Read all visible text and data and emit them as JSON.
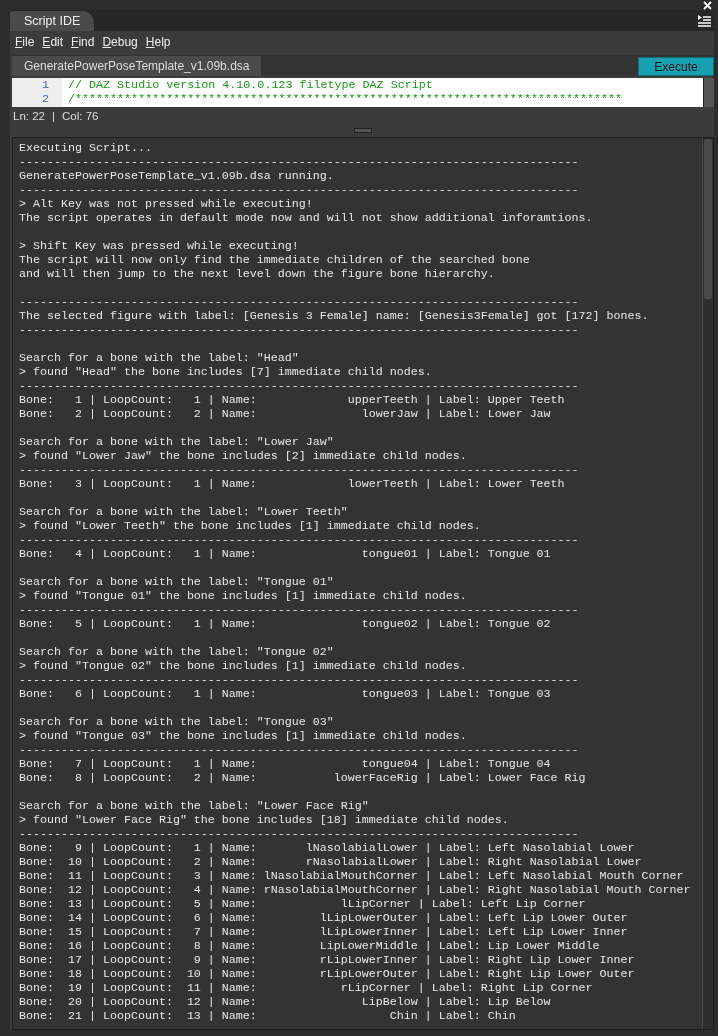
{
  "window": {
    "title": "Script IDE",
    "selected": true
  },
  "menu": [
    "File",
    "Edit",
    "Find",
    "Debug",
    "Help"
  ],
  "file_tab": {
    "label": "GeneratePowerPoseTemplate_v1.09b.dsa",
    "selected": true
  },
  "execute_button": "Execute",
  "editor": {
    "lines": [
      {
        "number": "1",
        "text": "// DAZ Studio version 4.10.0.123 filetype DAZ Script"
      },
      {
        "number": "2",
        "text": "/******************************************************************************"
      }
    ]
  },
  "status": {
    "line": "Ln: 22",
    "separator": "|",
    "column": "Col: 76"
  },
  "output": {
    "blocks": [
      [
        "Executing Script...",
        "--------------------------------------------------------------------------------",
        "GeneratePowerPoseTemplate_v1.09b.dsa running.",
        "--------------------------------------------------------------------------------",
        "> Alt Key was not pressed while executing!",
        "The script operates in default mode now and will not show additional inforamtions."
      ],
      [
        "> Shift Key was pressed while executing!",
        "The script will now only find the immediate children of the searched bone",
        "and will then jump to the next level down the figure bone hierarchy."
      ],
      [
        "--------------------------------------------------------------------------------",
        "The selected figure with label: [Genesis 3 Female] name: [Genesis3Female] got [172] bones.",
        "--------------------------------------------------------------------------------"
      ],
      [
        "Search for a bone with the label: \"Head\"",
        "> found \"Head\" the bone includes [7] immediate child nodes.",
        "--------------------------------------------------------------------------------",
        "Bone:   1 | LoopCount:   1 | Name:             upperTeeth | Label: Upper Teeth",
        "Bone:   2 | LoopCount:   2 | Name:               lowerJaw | Label: Lower Jaw"
      ],
      [
        "Search for a bone with the label: \"Lower Jaw\"",
        "> found \"Lower Jaw\" the bone includes [2] immediate child nodes.",
        "--------------------------------------------------------------------------------",
        "Bone:   3 | LoopCount:   1 | Name:             lowerTeeth | Label: Lower Teeth"
      ],
      [
        "Search for a bone with the label: \"Lower Teeth\"",
        "> found \"Lower Teeth\" the bone includes [1] immediate child nodes.",
        "--------------------------------------------------------------------------------",
        "Bone:   4 | LoopCount:   1 | Name:               tongue01 | Label: Tongue 01"
      ],
      [
        "Search for a bone with the label: \"Tongue 01\"",
        "> found \"Tongue 01\" the bone includes [1] immediate child nodes.",
        "--------------------------------------------------------------------------------",
        "Bone:   5 | LoopCount:   1 | Name:               tongue02 | Label: Tongue 02"
      ],
      [
        "Search for a bone with the label: \"Tongue 02\"",
        "> found \"Tongue 02\" the bone includes [1] immediate child nodes.",
        "--------------------------------------------------------------------------------",
        "Bone:   6 | LoopCount:   1 | Name:               tongue03 | Label: Tongue 03"
      ],
      [
        "Search for a bone with the label: \"Tongue 03\"",
        "> found \"Tongue 03\" the bone includes [1] immediate child nodes.",
        "--------------------------------------------------------------------------------",
        "Bone:   7 | LoopCount:   1 | Name:               tongue04 | Label: Tongue 04",
        "Bone:   8 | LoopCount:   2 | Name:           lowerFaceRig | Label: Lower Face Rig"
      ],
      [
        "Search for a bone with the label: \"Lower Face Rig\"",
        "> found \"Lower Face Rig\" the bone includes [18] immediate child nodes.",
        "--------------------------------------------------------------------------------",
        "Bone:   9 | LoopCount:   1 | Name:       lNasolabialLower | Label: Left Nasolabial Lower",
        "Bone:  10 | LoopCount:   2 | Name:       rNasolabialLower | Label: Right Nasolabial Lower",
        "Bone:  11 | LoopCount:   3 | Name: lNasolabialMouthCorner | Label: Left Nasolabial Mouth Corner",
        "Bone:  12 | LoopCount:   4 | Name: rNasolabialMouthCorner | Label: Right Nasolabial Mouth Corner",
        "Bone:  13 | LoopCount:   5 | Name:            lLipCorner | Label: Left Lip Corner",
        "Bone:  14 | LoopCount:   6 | Name:         lLipLowerOuter | Label: Left Lip Lower Outer",
        "Bone:  15 | LoopCount:   7 | Name:         lLipLowerInner | Label: Left Lip Lower Inner",
        "Bone:  16 | LoopCount:   8 | Name:         LipLowerMiddle | Label: Lip Lower Middle",
        "Bone:  17 | LoopCount:   9 | Name:         rLipLowerInner | Label: Right Lip Lower Inner",
        "Bone:  18 | LoopCount:  10 | Name:         rLipLowerOuter | Label: Right Lip Lower Outer",
        "Bone:  19 | LoopCount:  11 | Name:            rLipCorner | Label: Right Lip Corner",
        "Bone:  20 | LoopCount:  12 | Name:               LipBelow | Label: Lip Below",
        "Bone:  21 | LoopCount:  13 | Name:                   Chin | Label: Chin"
      ]
    ]
  }
}
